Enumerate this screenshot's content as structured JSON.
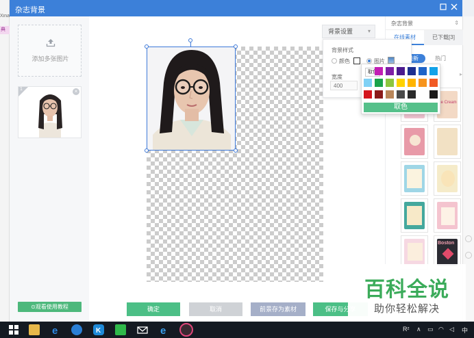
{
  "window": {
    "title": "杂志背景"
  },
  "left_strip": {
    "text_top": "Xinao",
    "text_tag": "典"
  },
  "left_panel": {
    "upload_label": "添加多张图片",
    "thumbnail": {
      "index": "1"
    },
    "tutorial_label": "⊙观看使用教程"
  },
  "canvas": {
    "bg_settings": {
      "label": "背景设置"
    },
    "bg_panel": {
      "title": "背景样式",
      "option_color": "颜色",
      "option_image": "图片",
      "width_label": "宽度",
      "width_value": "400"
    },
    "color_popup": {
      "tooltip": "取色",
      "pick_label": "取色",
      "colors": [
        [
          "#ff2a6d",
          "#c21fb4",
          "#7f1fa6",
          "#4b1a8e",
          "#1c2f8f",
          "#1e64c8",
          "#12a2e8"
        ],
        [
          "#7fd1f5",
          "#1aa34a",
          "#8dc63f",
          "#ffd200",
          "#ffb400",
          "#f7941d",
          "#f15a24"
        ],
        [
          "#d4141c",
          "#8b1a1a",
          "#b9865a",
          "#4a4a4a",
          "#2b2b2b",
          "#ffffff",
          "#1a1a1a"
        ]
      ]
    },
    "buttons": {
      "confirm": "确定",
      "cancel": "取消",
      "save_material": "前景存为素材",
      "save_share": "保存与分享"
    }
  },
  "right_panel": {
    "header": "杂志背景",
    "tabs": {
      "online": "在线素材",
      "downloaded": "已下载[3]"
    },
    "subtabs": {
      "newest": "最新",
      "hot": "热门"
    },
    "cards": [
      {
        "color": "#f4c7d4",
        "text": ""
      },
      {
        "color": "#f3d9c5",
        "text": "Ice Cream"
      },
      {
        "color": "#e89aa8",
        "text": ""
      },
      {
        "color": "#f2e1c4",
        "text": ""
      },
      {
        "color": "#9fd6e6",
        "text": ""
      },
      {
        "color": "#f5ebc9",
        "text": ""
      },
      {
        "color": "#44a89d",
        "text": ""
      },
      {
        "color": "#f4c4cf",
        "text": ""
      },
      {
        "color": "#f6d8e2",
        "text": ""
      },
      {
        "color": "#2a2a32",
        "text": "Boston"
      }
    ]
  },
  "watermark": {
    "title": "百科全说",
    "subtitle": "助你轻松解决"
  },
  "taskbar": {
    "tray_text": "R²",
    "ime": "中",
    "apps": [
      "start-icon",
      "file-explorer-icon",
      "edge-icon",
      "sogou-icon",
      "app-k-icon",
      "app-green-icon",
      "mail-icon",
      "ie-icon",
      "beauty-app-icon"
    ]
  }
}
